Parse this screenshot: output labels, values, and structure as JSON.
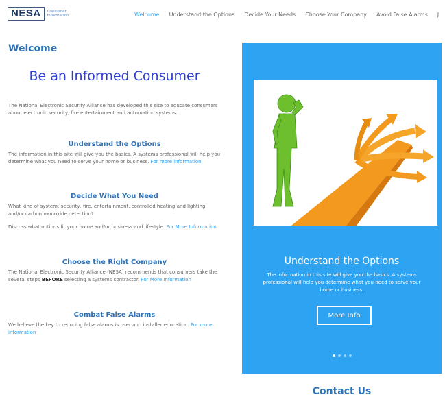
{
  "header": {
    "logo_text": "NESA",
    "logo_subtitle": "Consumer Information",
    "nav": [
      {
        "label": "Welcome",
        "active": true
      },
      {
        "label": "Understand the Options",
        "active": false
      },
      {
        "label": "Decide Your Needs",
        "active": false
      },
      {
        "label": "Choose Your Company",
        "active": false
      },
      {
        "label": "Avoid False Alarms",
        "active": false
      },
      {
        "label": "J",
        "active": false
      }
    ]
  },
  "main": {
    "page_title": "Welcome",
    "hero_title": "Be an Informed Consumer",
    "intro": "The National Electronic Security Alliance has developed this site to educate consumers about electronic security, fire entertainment and automation systems.",
    "sections": [
      {
        "heading": "Understand the Options",
        "text": "The information in this site will give you the basics. A systems professional will help you determine what you need to serve your home or business.",
        "link": "For more information"
      },
      {
        "heading": "Decide What You Need",
        "text": "What kind of system: security, fire, entertainment, controlled heating and lighting, and/or carbon monoxide detection?",
        "text2": "Discuss what options fit your home and/or business and lifestyle.",
        "link": "For More Information"
      },
      {
        "heading": "Choose the Right Company",
        "text_before": "The National Electronic Security Alliance (NESA) recommends that consumers take the several steps",
        "text_bold": "BEFORE",
        "text_after": "selecting a systems contractor.",
        "link": "For More Information"
      },
      {
        "heading": "Combat False Alarms",
        "text": "We believe the key to reducing false alarms is user and installer education.",
        "link": "For more information"
      }
    ]
  },
  "slider": {
    "title": "Understand the Options",
    "text": "The information in this site will give you the basics. A systems professional will help you determine what you need to serve your home or business.",
    "button": "More Info",
    "dots": 4,
    "active_dot": 1,
    "image_icon": "person-crossroads-arrows-illustration"
  },
  "footer": {
    "contact_title": "Contact Us"
  },
  "colors": {
    "accent": "#2ea3f2",
    "heading": "#2e72b8",
    "hero": "#2f3ed1",
    "arrows": "#f39a1e",
    "figure": "#6dbf2e"
  }
}
